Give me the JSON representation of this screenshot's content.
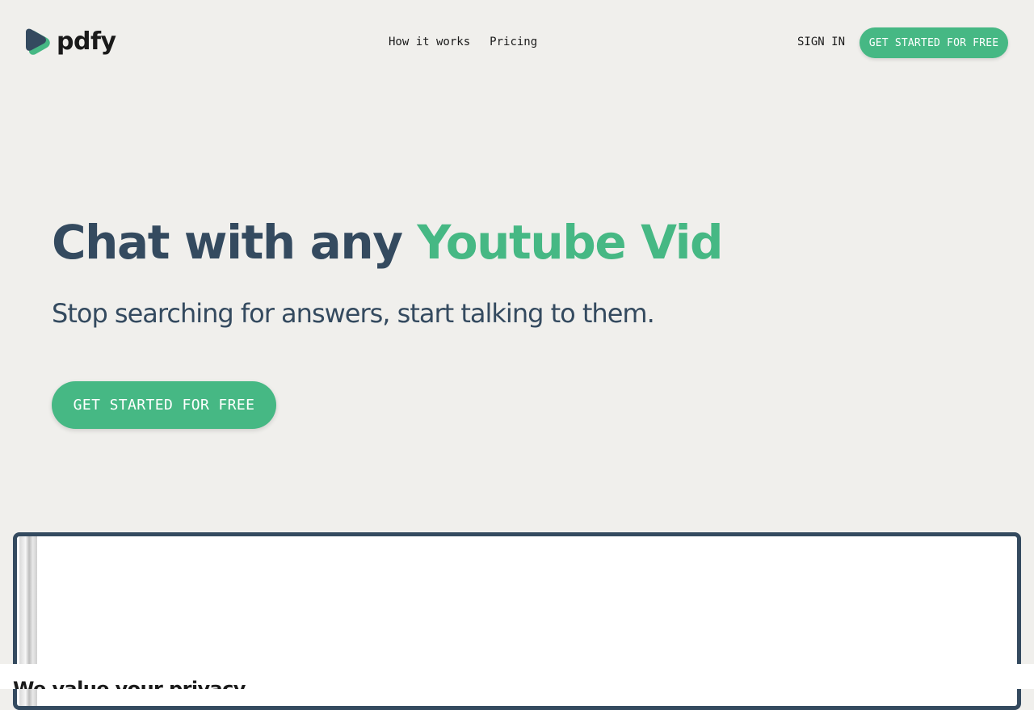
{
  "header": {
    "logo_text": "pdfy",
    "logo_icon": "play-leaf-icon",
    "nav": {
      "how_it_works": "How it works",
      "pricing": "Pricing"
    },
    "sign_in": "SIGN IN",
    "cta": "GET STARTED FOR FREE"
  },
  "hero": {
    "title_main": "Chat with any",
    "title_accent": "Youtube Vid",
    "subtitle": "Stop searching for answers, start talking to them.",
    "cta": "GET STARTED FOR FREE"
  },
  "privacy": {
    "title": "We value your privacy"
  },
  "colors": {
    "background": "#f0efec",
    "accent": "#46b884",
    "heading": "#344a5f",
    "logo_dark": "#344a5f"
  }
}
